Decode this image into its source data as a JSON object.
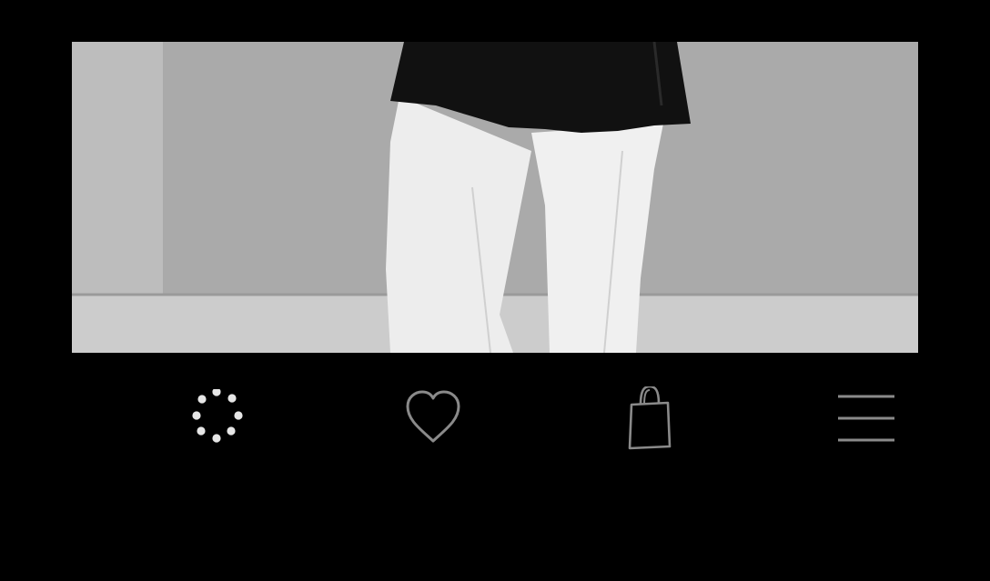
{
  "product_image": {
    "alt": "",
    "icon": "photo-placeholder"
  },
  "bottom_nav": {
    "items": [
      {
        "name": "loading",
        "icon": "loading-spinner-icon"
      },
      {
        "name": "favorites",
        "icon": "heart-icon"
      },
      {
        "name": "bag",
        "icon": "shopping-bag-icon"
      },
      {
        "name": "menu",
        "icon": "hamburger-menu-icon"
      }
    ]
  },
  "colors": {
    "background": "#000000",
    "icon_active": "#e6e6e6",
    "icon_inactive": "#8a8a8a"
  }
}
